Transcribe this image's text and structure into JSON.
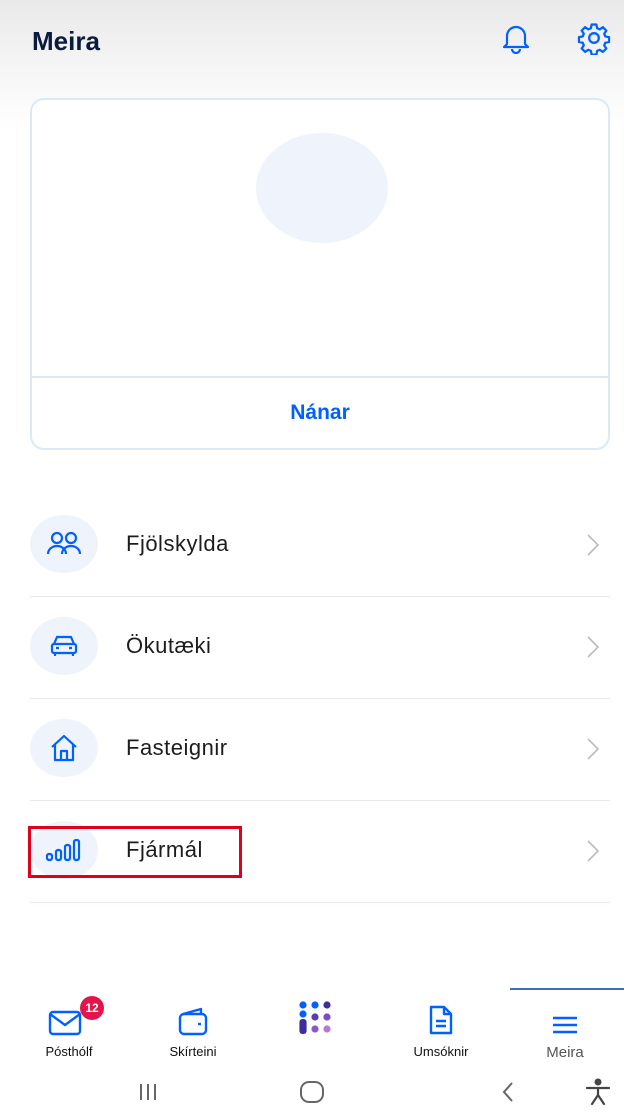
{
  "header": {
    "title": "Meira",
    "icons": [
      "bell-icon",
      "gear-icon"
    ]
  },
  "profile_card": {
    "link_label": "Nánar"
  },
  "menu": {
    "items": [
      {
        "label": "Fjölskylda",
        "icon": "people-icon"
      },
      {
        "label": "Ökutæki",
        "icon": "car-icon"
      },
      {
        "label": "Fasteignir",
        "icon": "house-icon"
      },
      {
        "label": "Fjármál",
        "icon": "bar-chart-icon"
      }
    ]
  },
  "tabbar": {
    "tabs": [
      {
        "label": "Pósthólf",
        "icon": "mail-icon",
        "badge": "12"
      },
      {
        "label": "Skírteini",
        "icon": "wallet-icon"
      },
      {
        "label": "",
        "icon": "island-logo-icon"
      },
      {
        "label": "Umsóknir",
        "icon": "document-icon"
      },
      {
        "label": "Meira",
        "icon": "menu-icon"
      }
    ],
    "active_index": 4
  },
  "colors": {
    "accent": "#0061ff",
    "icon_blue": "#0061ff",
    "badge": "#e3154a",
    "highlight": "#e0001b"
  }
}
